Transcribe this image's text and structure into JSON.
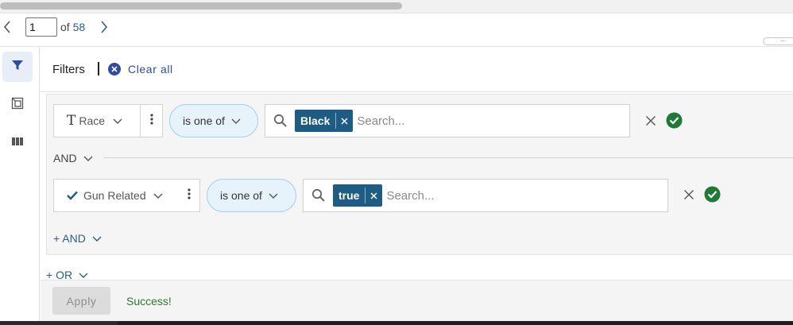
{
  "pagination": {
    "current_page": "1",
    "of_label": "of",
    "total_pages": "58"
  },
  "icons": {
    "prev": "chevron-left-icon",
    "next": "chevron-right-icon",
    "filter": "filter-icon",
    "view": "view-icon",
    "columns": "columns-icon",
    "clear": "close-circle-icon",
    "type_text": "text-type-icon",
    "type_boolean": "checkmark-icon",
    "chevron": "chevron-down-icon",
    "kebab": "more-vertical-icon",
    "search": "search-icon",
    "remove": "close-icon",
    "valid": "check-circle-icon"
  },
  "filters_panel": {
    "title": "Filters",
    "clear_all_label": "Clear all"
  },
  "conditions": [
    {
      "field": "Race",
      "operator": "is one of",
      "values": [
        "Black"
      ],
      "search_placeholder": "Search..."
    },
    {
      "field": "Gun Related",
      "operator": "is one of",
      "values": [
        "true"
      ],
      "search_placeholder": "Search..."
    }
  ],
  "connectors": {
    "and_label": "AND",
    "add_and_label": "+ AND",
    "add_or_label": "+ OR"
  },
  "footer": {
    "apply_label": "Apply",
    "status_text": "Success!"
  },
  "colors": {
    "accent": "#2e4d9e",
    "chip": "#1f5c84",
    "success": "#2b7a2b",
    "valid_icon": "#1e7a35",
    "pill_border": "#9ed0ec"
  }
}
